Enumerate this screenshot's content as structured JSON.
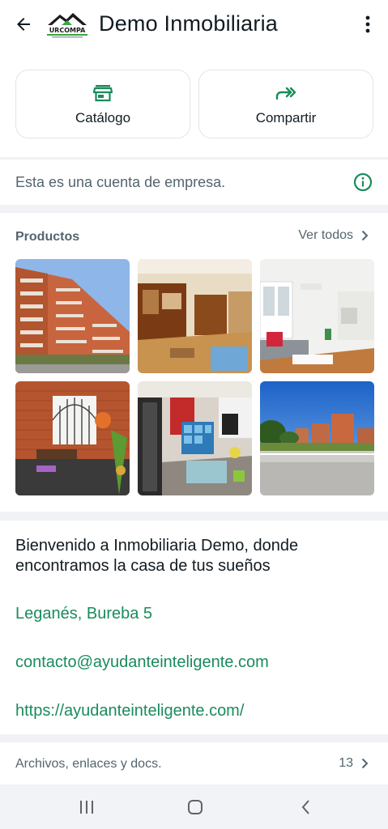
{
  "header": {
    "title": "Demo Inmobiliaria",
    "back_icon": "arrow-left-icon",
    "menu_icon": "more-vertical-icon",
    "logo_text": "URCOMPA"
  },
  "actions": [
    {
      "label": "Catálogo",
      "icon": "storefront-icon"
    },
    {
      "label": "Compartir",
      "icon": "forward-share-icon"
    }
  ],
  "business_note": {
    "text": "Esta es una cuenta de empresa.",
    "icon": "info-icon"
  },
  "products": {
    "title": "Productos",
    "see_all": "Ver todos",
    "items": [
      {
        "icon": "apartment-building-photo"
      },
      {
        "icon": "living-room-photo"
      },
      {
        "icon": "white-living-room-photo"
      },
      {
        "icon": "brick-patio-photo"
      },
      {
        "icon": "studio-room-photo"
      },
      {
        "icon": "street-buildings-photo"
      }
    ]
  },
  "description": {
    "bio": "Bienvenido a Inmobiliaria Demo, donde encontramos la casa de tus sueños",
    "address": "Leganés, Bureba 5",
    "email": "contacto@ayudanteinteligente.com",
    "website": "https://ayudanteinteligente.com/"
  },
  "files": {
    "label": "Archivos, enlaces y docs.",
    "count": "13"
  },
  "colors": {
    "accent": "#1a8b5c",
    "text_secondary": "#54656f",
    "background": "#f0f2f5"
  }
}
